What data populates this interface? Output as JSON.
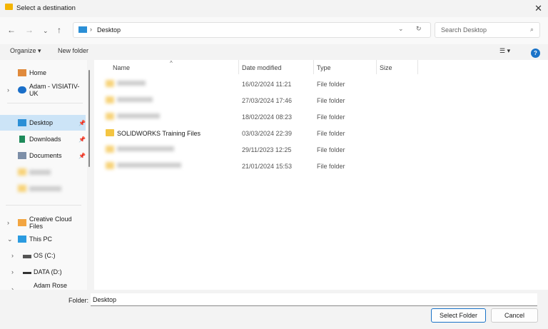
{
  "window": {
    "title": "Select a destination"
  },
  "nav": {
    "path": "Desktop",
    "search_placeholder": "Search Desktop"
  },
  "toolbar": {
    "organize": "Organize",
    "new_folder": "New folder"
  },
  "columns": {
    "name": "Name",
    "date": "Date modified",
    "type": "Type",
    "size": "Size"
  },
  "sidebar": {
    "home": "Home",
    "onedrive": "Adam - VISIATIV-UK",
    "desktop": "Desktop",
    "downloads": "Downloads",
    "documents": "Documents",
    "creative": "Creative Cloud Files",
    "thispc": "This PC",
    "c": "OS (C:)",
    "d": "DATA (D:)",
    "net": "Adam Rose (\\\\ipso"
  },
  "files": [
    {
      "name": "",
      "date": "16/02/2024 11:21",
      "type": "File folder",
      "blurred": true
    },
    {
      "name": "",
      "date": "27/03/2024 17:46",
      "type": "File folder",
      "blurred": true
    },
    {
      "name": "",
      "date": "18/02/2024 08:23",
      "type": "File folder",
      "blurred": true
    },
    {
      "name": "SOLIDWORKS Training Files",
      "date": "03/03/2024 22:39",
      "type": "File folder",
      "blurred": false
    },
    {
      "name": "",
      "date": "29/11/2023 12:25",
      "type": "File folder",
      "blurred": true
    },
    {
      "name": "",
      "date": "21/01/2024 15:53",
      "type": "File folder",
      "blurred": true
    }
  ],
  "footer": {
    "folder_label": "Folder:",
    "folder_value": "Desktop",
    "select": "Select Folder",
    "cancel": "Cancel"
  }
}
